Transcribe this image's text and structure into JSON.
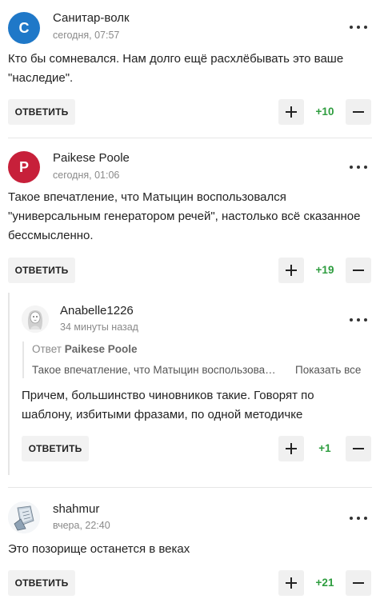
{
  "comments": [
    {
      "avatar_letter": "С",
      "avatar_color": "#1f78c8",
      "author": "Санитар-волк",
      "time": "сегодня, 07:57",
      "text": "Кто бы сомневался. Нам долго ещё расхлёбывать это ваше\n\"наследие\".",
      "reply_label": "ОТВЕТИТЬ",
      "score": "+10"
    },
    {
      "avatar_letter": "P",
      "avatar_color": "#c7203a",
      "author": "Paikese Poole",
      "time": "сегодня, 01:06",
      "text": "Такое впечатление, что Матыцин воспользовался\n\"универсальным генератором речей\", настолько всё сказанное\nбессмысленно.",
      "reply_label": "ОТВЕТИТЬ",
      "score": "+19"
    },
    {
      "author": "Anabelle1226",
      "time": "34 минуты назад",
      "quote_prefix": "Ответ",
      "quote_author": "Paikese Poole",
      "quote_text": "Такое впечатление, что Матыцин воспользовался \"универсальным генератором речей\"",
      "show_all": "Показать все",
      "text": "Причем, большинство чиновников такие. Говорят по\nшаблону, избитыми фразами, по одной методичке",
      "reply_label": "ОТВЕТИТЬ",
      "score": "+1"
    },
    {
      "author": "shahmur",
      "time": "вчера, 22:40",
      "text": "Это позорище останется в веках",
      "reply_label": "ОТВЕТИТЬ",
      "score": "+21"
    }
  ],
  "icons": {
    "more": "more-icon",
    "upvote": "plus-icon",
    "downvote": "minus-icon"
  },
  "colors": {
    "score_green": "#2e9d3f",
    "button_bg": "#f2f2f2"
  }
}
